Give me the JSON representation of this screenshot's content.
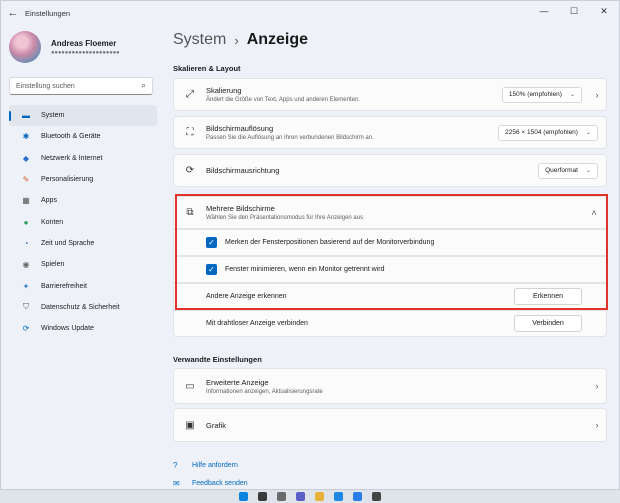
{
  "window": {
    "title": "Einstellungen",
    "back_icon": "back-arrow-icon"
  },
  "controls": {
    "minimize": "—",
    "maximize": "☐",
    "close": "✕"
  },
  "profile": {
    "name": "Andreas Floemer",
    "email": "●●●●●●●●●●●●●●●●●●●●"
  },
  "search": {
    "placeholder": "Einstellung suchen",
    "icon": "search-icon"
  },
  "sidebar": {
    "items": [
      {
        "label": "System",
        "icon": "▬",
        "color": "#0067c0",
        "active": true
      },
      {
        "label": "Bluetooth & Geräte",
        "icon": "✱",
        "color": "#0067c0"
      },
      {
        "label": "Netzwerk & Internet",
        "icon": "◆",
        "color": "#2a6fc9"
      },
      {
        "label": "Personalisierung",
        "icon": "✎",
        "color": "#d2622a"
      },
      {
        "label": "Apps",
        "icon": "▦",
        "color": "#555"
      },
      {
        "label": "Konten",
        "icon": "●",
        "color": "#2a9d5c"
      },
      {
        "label": "Zeit und Sprache",
        "icon": "◔",
        "color": "#2a6fc9"
      },
      {
        "label": "Spielen",
        "icon": "◉",
        "color": "#666"
      },
      {
        "label": "Barrierefreiheit",
        "icon": "✦",
        "color": "#3a7bd5"
      },
      {
        "label": "Datenschutz & Sicherheit",
        "icon": "⛉",
        "color": "#555"
      },
      {
        "label": "Windows Update",
        "icon": "⟳",
        "color": "#0067c0"
      }
    ]
  },
  "breadcrumb": {
    "parent": "System",
    "separator": "›",
    "current": "Anzeige"
  },
  "sections": {
    "scale_layout": "Skalieren & Layout",
    "related": "Verwandte Einstellungen"
  },
  "settings": {
    "scaling": {
      "title": "Skalierung",
      "desc": "Ändert die Größe von Text, Apps und anderen Elementen.",
      "value": "150% (empfohlen)"
    },
    "resolution": {
      "title": "Bildschirmauflösung",
      "desc": "Passen Sie die Auflösung an Ihren verbundenen Bildschirm an.",
      "value": "2256 × 1504 (empfohlen)"
    },
    "orientation": {
      "title": "Bildschirmausrichtung",
      "value": "Querformat"
    },
    "multi_display": {
      "title": "Mehrere Bildschirme",
      "desc": "Wählen Sie den Präsentationsmodus für Ihre Anzeigen aus",
      "opt1": "Merken der Fensterpositionen basierend auf der Monitorverbindung",
      "opt2": "Fenster minimieren, wenn ein Monitor getrennt wird",
      "detect_label": "Andere Anzeige erkennen",
      "detect_button": "Erkennen",
      "wireless_label": "Mit drahtloser Anzeige verbinden",
      "wireless_button": "Verbinden"
    },
    "advanced": {
      "title": "Erweiterte Anzeige",
      "desc": "Informationen anzeigen, Aktualisierungsrate"
    },
    "graphics": {
      "title": "Grafik"
    }
  },
  "links": {
    "help": "Hilfe anfordern",
    "feedback": "Feedback senden"
  },
  "colors": {
    "accent": "#0067c0",
    "highlight": "#e0342a"
  }
}
